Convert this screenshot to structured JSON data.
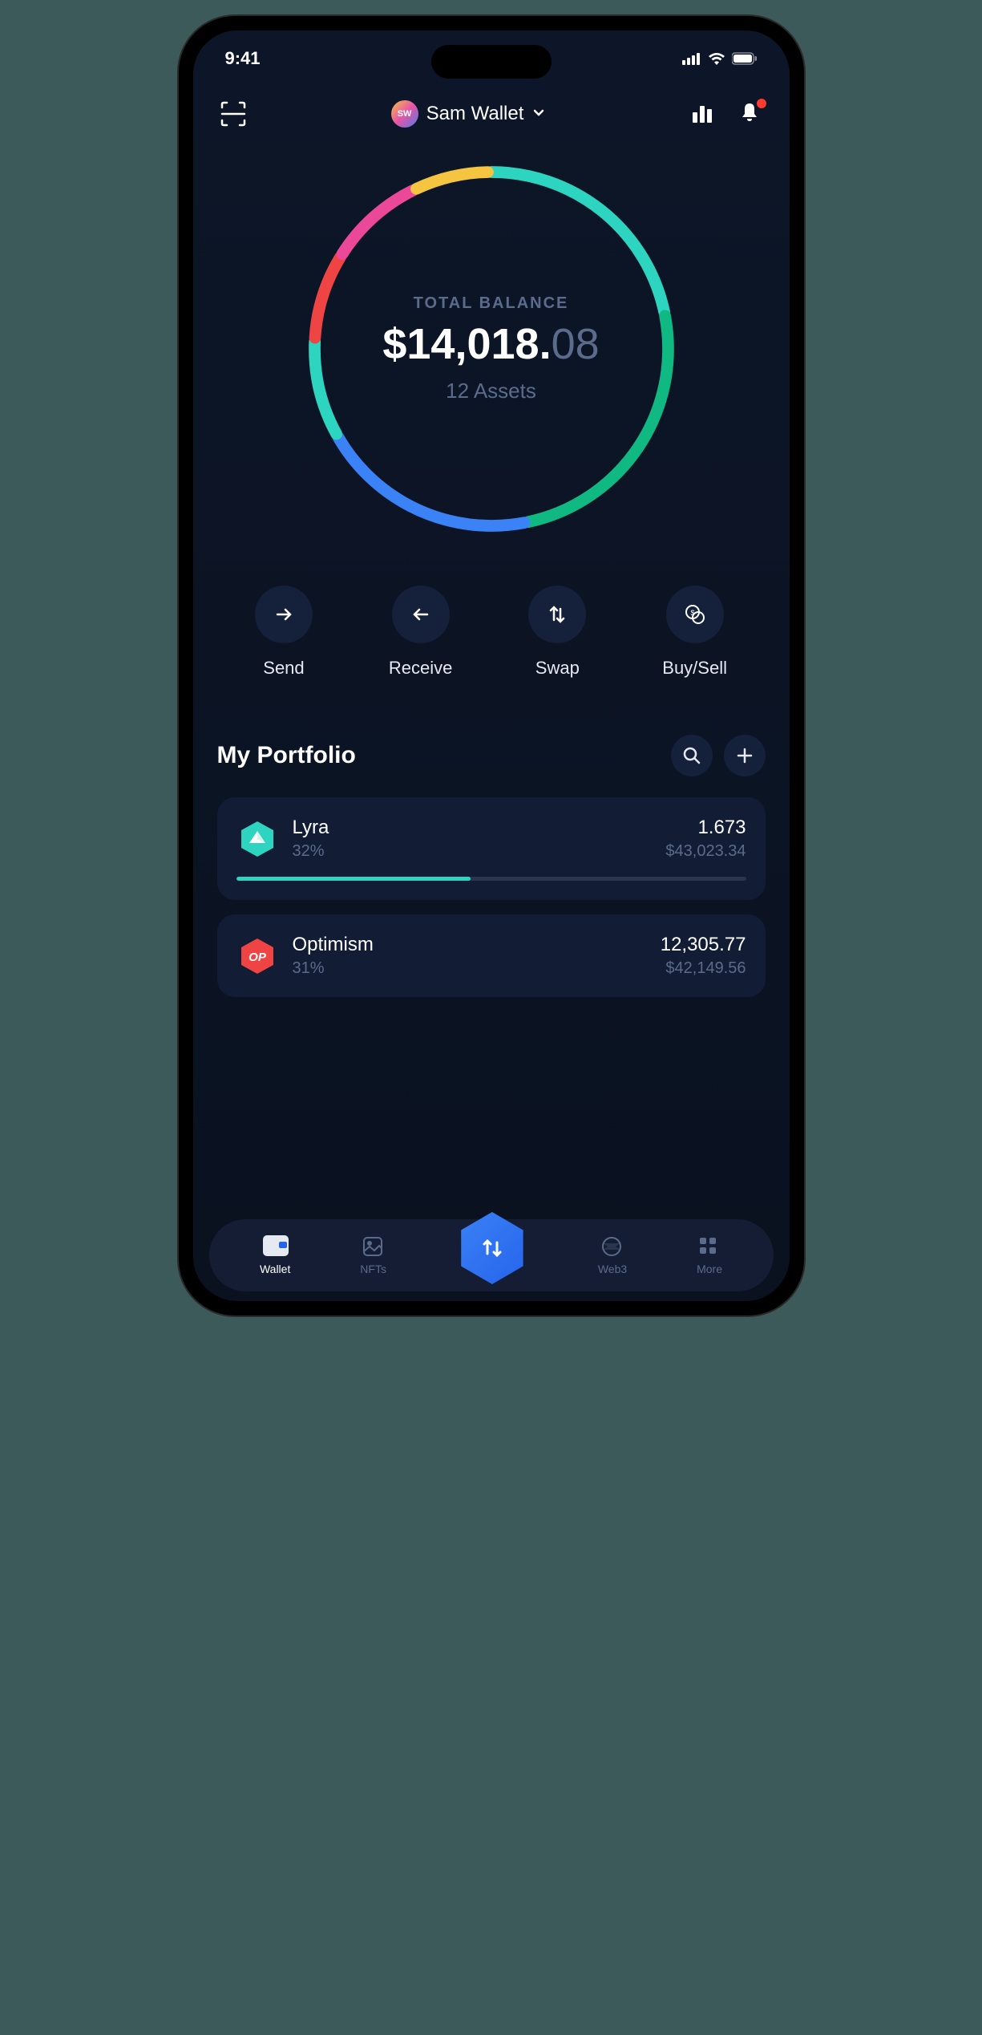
{
  "status_bar": {
    "time": "9:41"
  },
  "header": {
    "avatar_initials": "SW",
    "wallet_name": "Sam Wallet"
  },
  "balance": {
    "label": "TOTAL BALANCE",
    "currency": "$",
    "major": "14,018.",
    "minor": "08",
    "assets_text": "12 Assets"
  },
  "chart_data": {
    "type": "pie",
    "title": "Portfolio allocation",
    "segments": [
      {
        "name": "teal-top",
        "value": 22,
        "color": "#2dd4bf"
      },
      {
        "name": "green",
        "value": 25,
        "color": "#10b981"
      },
      {
        "name": "blue",
        "value": 20,
        "color": "#3b82f6"
      },
      {
        "name": "teal-left",
        "value": 9,
        "color": "#2dd4bf"
      },
      {
        "name": "red",
        "value": 8,
        "color": "#ef4444"
      },
      {
        "name": "magenta",
        "value": 9,
        "color": "#ec4899"
      },
      {
        "name": "yellow",
        "value": 7,
        "color": "#f5c542"
      }
    ]
  },
  "actions": {
    "send": "Send",
    "receive": "Receive",
    "swap": "Swap",
    "buy_sell": "Buy/Sell"
  },
  "portfolio": {
    "title": "My Portfolio",
    "items": [
      {
        "name": "Lyra",
        "percent": "32%",
        "amount": "1.673",
        "usd": "$43,023.34",
        "progress": 46,
        "icon_color": "#2dd4bf",
        "icon_type": "hex-lyra"
      },
      {
        "name": "Optimism",
        "percent": "31%",
        "amount": "12,305.77",
        "usd": "$42,149.56",
        "icon_color": "#ef4444",
        "icon_type": "hex-op",
        "icon_text": "OP"
      }
    ]
  },
  "nav": {
    "wallet": "Wallet",
    "nfts": "NFTs",
    "web3": "Web3",
    "more": "More"
  }
}
